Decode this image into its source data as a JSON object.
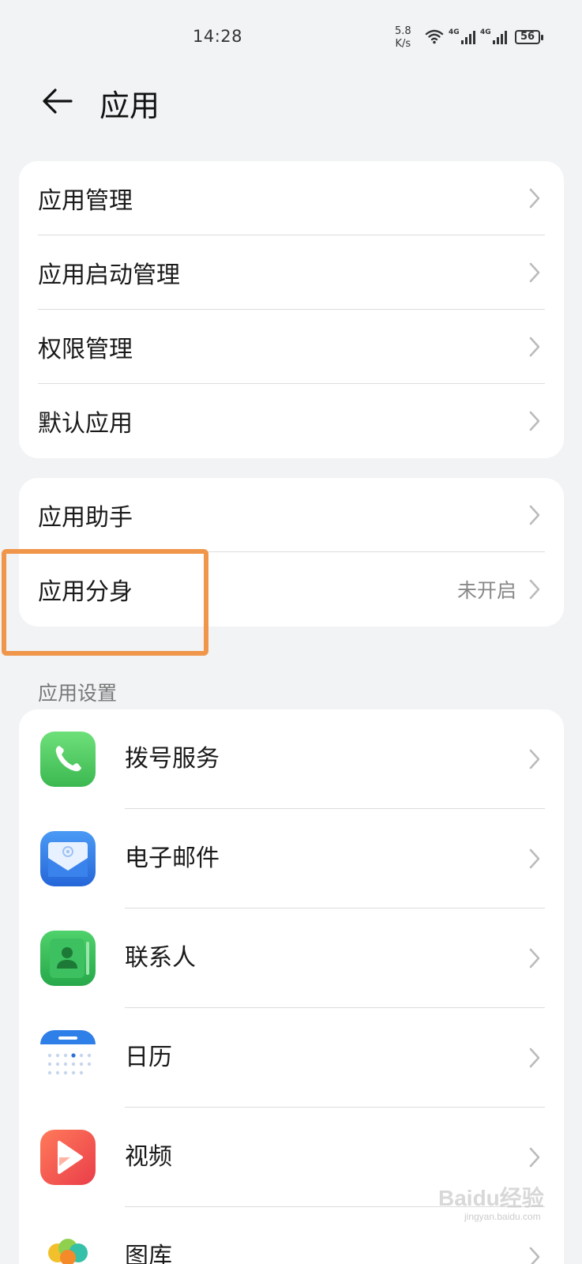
{
  "status_bar": {
    "time": "14:28",
    "net_speed_value": "5.8",
    "net_speed_unit": "K/s",
    "network_tags": [
      "4G",
      "4G"
    ],
    "battery": "56"
  },
  "header": {
    "title": "应用"
  },
  "group1": [
    {
      "label": "应用管理"
    },
    {
      "label": "应用启动管理"
    },
    {
      "label": "权限管理"
    },
    {
      "label": "默认应用"
    }
  ],
  "group2": [
    {
      "label": "应用助手"
    },
    {
      "label": "应用分身",
      "value": "未开启"
    }
  ],
  "app_settings": {
    "header": "应用设置",
    "items": [
      {
        "label": "拨号服务",
        "icon": "phone-icon",
        "color": "#4cc85f"
      },
      {
        "label": "电子邮件",
        "icon": "email-icon",
        "color": "#2f7fe8"
      },
      {
        "label": "联系人",
        "icon": "contacts-icon",
        "color": "#34b85a"
      },
      {
        "label": "日历",
        "icon": "calendar-icon",
        "color": "#2f7fe8"
      },
      {
        "label": "视频",
        "icon": "video-icon",
        "color": "#f0564a"
      },
      {
        "label": "图库",
        "icon": "gallery-icon",
        "color": "#f2b52a"
      }
    ]
  },
  "highlight_color": "#f0964a",
  "watermark": {
    "text": "Baidu经验",
    "sub": "jingyan.baidu.com"
  }
}
